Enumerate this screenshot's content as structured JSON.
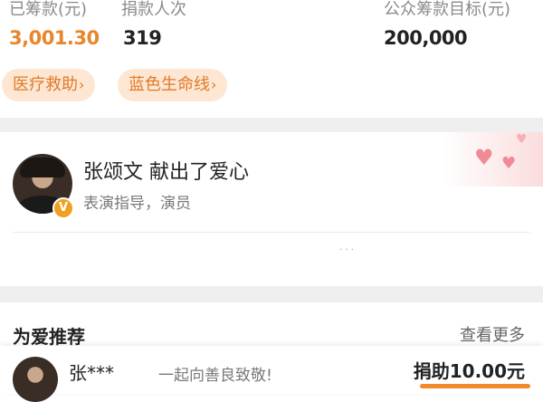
{
  "stats": {
    "raised_label": "已筹款(元)",
    "raised_value": "3,001.30",
    "donors_label": "捐款人次",
    "donors_value": "319",
    "target_label": "公众筹款目标(元)",
    "target_value": "200,000"
  },
  "tags": [
    {
      "label": "医疗救助",
      "chevron": "›"
    },
    {
      "label": "蓝色生命线",
      "chevron": "›"
    }
  ],
  "donor_card": {
    "name_line": "张颂文 献出了爱心",
    "subtitle": "表演指导，演员",
    "verified_badge": "V",
    "dots": "·  ·  ·",
    "hearts": [
      "♥",
      "♥",
      "♥"
    ]
  },
  "section": {
    "title": "为爱推荐",
    "more": "查看更多"
  },
  "bottom_bar": {
    "name": "张***",
    "message": "一起向善良致敬!",
    "amount": "捐助10.00元"
  },
  "colors": {
    "accent": "#e8862b",
    "tag_bg": "#fde7d3",
    "tag_text": "#e07a28",
    "divider_band": "#efefef"
  },
  "icons": {
    "verified": "verified-badge-icon",
    "chevron": "chevron-right-icon",
    "heart": "heart-icon"
  }
}
